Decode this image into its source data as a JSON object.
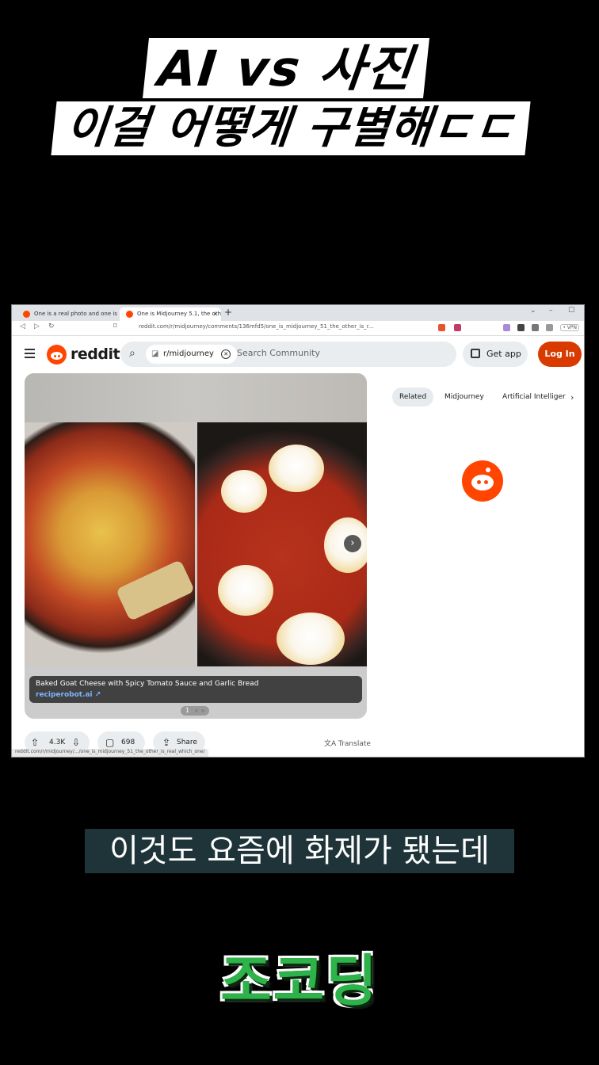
{
  "overlay": {
    "title_line1": "AI vs 사진",
    "title_line2": "이걸 어떻게 구별해ㄷㄷ",
    "subtitle": "이것도 요즘에 화제가 됐는데",
    "brand": "조코딩"
  },
  "browser": {
    "tabs": [
      {
        "label": "One is a real photo and one is AI..."
      },
      {
        "label": "One is Midjourney 5.1, the other..."
      }
    ],
    "new_tab": "+",
    "url": "reddit.com/r/midjourney/comments/136mfd5/one_is_midjourney_51_the_other_is_r...",
    "vpn": "• VPN",
    "status_url": "reddit.com/r/midjourney/.../one_is_midjourney_51_the_other_is_real_which_one/"
  },
  "reddit": {
    "wordmark": "reddit",
    "community_chip": "r/midjourney",
    "search_placeholder": "Search Community",
    "get_app": "Get app",
    "login": "Log In",
    "caption_title": "Baked Goat Cheese with Spicy Tomato Sauce and Garlic Bread",
    "caption_link": "reciperobot.ai",
    "carousel_index": "1",
    "upvotes": "4.3K",
    "comments": "698",
    "share": "Share",
    "translate": "Translate",
    "side_tabs": [
      "Related",
      "Midjourney",
      "Artificial Intelliger"
    ]
  },
  "colors": {
    "reddit_orange": "#ff4500",
    "login_bg": "#d93a00",
    "subtitle_bg": "#1e3439",
    "brand_green": "#2db34a"
  },
  "icons": [
    "reddit-logo-icon",
    "search-icon",
    "close-icon",
    "qr-code-icon",
    "upvote-icon",
    "downvote-icon",
    "comment-icon",
    "share-icon",
    "translate-icon",
    "chevron-right-icon",
    "snoo-icon"
  ]
}
